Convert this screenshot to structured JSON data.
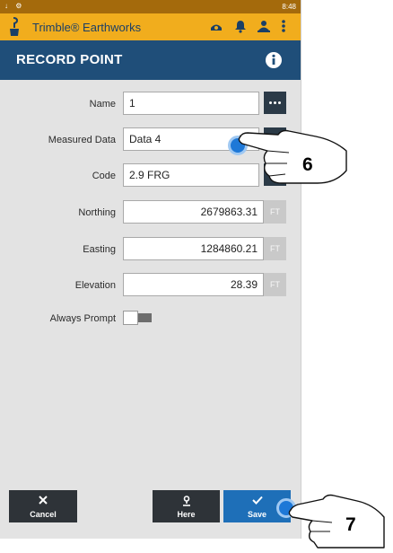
{
  "status_bar": {
    "left_icons": "↓ ⚙",
    "time": "8:48"
  },
  "app_bar": {
    "title": "Trimble® Earthworks",
    "icons": [
      "shovel-logo-icon",
      "grader-icon",
      "bell-icon",
      "person-icon",
      "overflow-menu-icon"
    ]
  },
  "header": {
    "title": "RECORD POINT",
    "info_icon": "info-icon"
  },
  "form": {
    "name": {
      "label": "Name",
      "value": "1"
    },
    "measured_data": {
      "label": "Measured Data",
      "value": "Data 4"
    },
    "code": {
      "label": "Code",
      "value": "2.9 FRG"
    },
    "northing": {
      "label": "Northing",
      "value": "2679863.31",
      "unit": "FT"
    },
    "easting": {
      "label": "Easting",
      "value": "1284860.21",
      "unit": "FT"
    },
    "elevation": {
      "label": "Elevation",
      "value": "28.39",
      "unit": "FT"
    },
    "always_prompt": {
      "label": "Always Prompt",
      "checked": false
    }
  },
  "buttons": {
    "cancel": "Cancel",
    "here": "Here",
    "save": "Save"
  },
  "callouts": {
    "step_a": "6",
    "step_b": "7"
  },
  "colors": {
    "header": "#1f4e79",
    "app_bar": "#f1ad1d",
    "status_bar": "#a46a0c",
    "save": "#1e6fb8",
    "tap_indicator": "#1e78d7"
  }
}
